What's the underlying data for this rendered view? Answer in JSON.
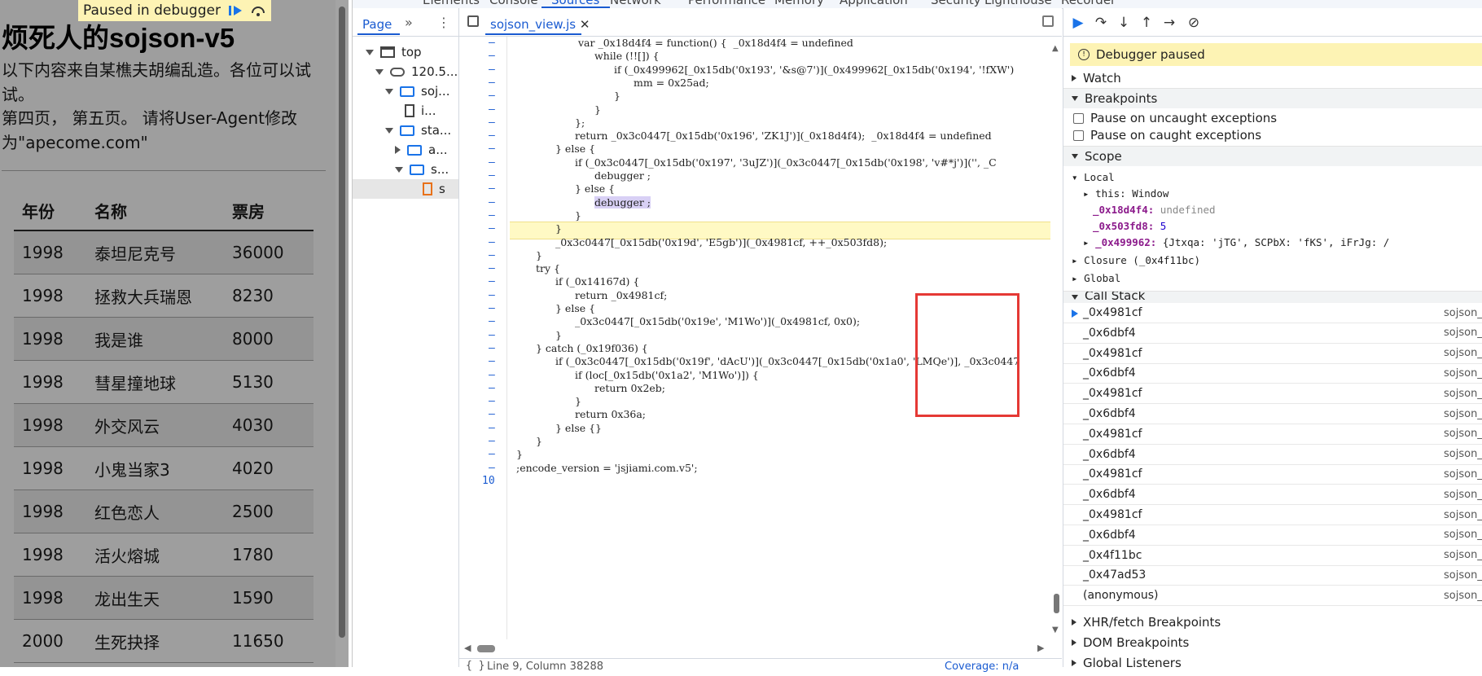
{
  "page": {
    "paused_badge": "Paused in debugger",
    "title": "烦死人的sojson-v5",
    "intro_1": "以下内容来自某樵夫胡编乱造。各位可以试试。",
    "intro_2": "第四页， 第五页。 请将User-Agent修改为\"apecome.com\"",
    "table": {
      "headers": [
        "年份",
        "名称",
        "票房"
      ],
      "rows": [
        [
          "1998",
          "泰坦尼克号",
          "36000"
        ],
        [
          "1998",
          "拯救大兵瑞恩",
          "8230"
        ],
        [
          "1998",
          "我是谁",
          "8000"
        ],
        [
          "1998",
          "彗星撞地球",
          "5130"
        ],
        [
          "1998",
          "外交风云",
          "4030"
        ],
        [
          "1998",
          "小鬼当家3",
          "4020"
        ],
        [
          "1998",
          "红色恋人",
          "2500"
        ],
        [
          "1998",
          "活火熔城",
          "1780"
        ],
        [
          "1998",
          "龙出生天",
          "1590"
        ],
        [
          "2000",
          "生死抉择",
          "11650"
        ]
      ]
    }
  },
  "devtools": {
    "top_tabs": [
      "Elements",
      "Console",
      "Sources",
      "Network",
      "Performance",
      "Memory",
      "Application",
      "Security",
      "Lighthouse",
      "Recorder"
    ],
    "navigator": {
      "tab": "Page",
      "tree": [
        {
          "label": "top"
        },
        {
          "label": "120.5..."
        },
        {
          "label": "soj..."
        },
        {
          "label": "i..."
        },
        {
          "label": "sta..."
        },
        {
          "label": "a..."
        },
        {
          "label": "s..."
        },
        {
          "label": "s"
        }
      ]
    },
    "editor": {
      "file_tab": "sojson_view.js",
      "gutter_dash": "–",
      "last_line_number": "10",
      "code_lines": [
        "var _0x18d4f4 = function() {  _0x18d4f4 = undefined",
        "while (!![]) {",
        "if (_0x499962[_0x15db('0x193', '&s@7')](_0x499962[_0x15db('0x194', '!fXW')",
        "mm = 0x25ad;",
        "}",
        "}",
        "};",
        "return _0x3c0447[_0x15db('0x196', 'ZK1J')](_0x18d4f4);  _0x18d4f4 = undefined",
        "} else {",
        "if (_0x3c0447[_0x15db('0x197', '3uJZ')](_0x3c0447[_0x15db('0x198', 'v#*j')]('', _C",
        "debugger ;",
        "} else {",
        "debugger ;",
        "}",
        "}",
        "_0x3c0447[_0x15db('0x19d', 'E5gb')](_0x4981cf, ++_0x503fd8);",
        "}",
        "try {",
        "if (_0x14167d) {",
        "return _0x4981cf;",
        "} else {",
        "_0x3c0447[_0x15db('0x19e', 'M1Wo')](_0x4981cf, 0x0);",
        "}",
        "} catch (_0x19f036) {",
        "if (_0x3c0447[_0x15db('0x19f', 'dAcU')](_0x3c0447[_0x15db('0x1a0', 'LMQe')], _0x3c0447",
        "if (loc[_0x15db('0x1a2', 'M1Wo')]) {",
        "return 0x2eb;",
        "}",
        "return 0x36a;",
        "} else {}",
        "}",
        "}",
        ";encode_version = 'jsjiami.com.v5';"
      ],
      "status": "Line 9, Column 38288",
      "coverage": "Coverage: n/a"
    },
    "sidebar": {
      "paused_banner": "Debugger paused",
      "watch": "Watch",
      "breakpoints": "Breakpoints",
      "pause_uncaught": "Pause on uncaught exceptions",
      "pause_caught": "Pause on caught exceptions",
      "scope": "Scope",
      "local": "Local",
      "this_label": "this: Window",
      "var1_name": "_0x18d4f4:",
      "var1_val": "undefined",
      "var2_name": "_0x503fd8:",
      "var2_val": "5",
      "var3_name": "_0x499962:",
      "var3_val": "{Jtxqa: 'jTG', SCPbX: 'fKS', iFrJg: /",
      "closure": "Closure (_0x4f11bc)",
      "global": "Global",
      "call_stack": "Call Stack",
      "frames": [
        {
          "fn": "_0x4981cf",
          "loc": "sojson_"
        },
        {
          "fn": "_0x6dbf4",
          "loc": "sojson_"
        },
        {
          "fn": "_0x4981cf",
          "loc": "sojson_"
        },
        {
          "fn": "_0x6dbf4",
          "loc": "sojson_"
        },
        {
          "fn": "_0x4981cf",
          "loc": "sojson_"
        },
        {
          "fn": "_0x6dbf4",
          "loc": "sojson_"
        },
        {
          "fn": "_0x4981cf",
          "loc": "sojson_"
        },
        {
          "fn": "_0x6dbf4",
          "loc": "sojson_"
        },
        {
          "fn": "_0x4981cf",
          "loc": "sojson_"
        },
        {
          "fn": "_0x6dbf4",
          "loc": "sojson_"
        },
        {
          "fn": "_0x4981cf",
          "loc": "sojson_"
        },
        {
          "fn": "_0x6dbf4",
          "loc": "sojson_"
        },
        {
          "fn": "_0x4f11bc",
          "loc": "sojson_"
        },
        {
          "fn": "_0x47ad53",
          "loc": "sojson_"
        },
        {
          "fn": "(anonymous)",
          "loc": "sojson_"
        }
      ],
      "xhr_breakpoints": "XHR/fetch Breakpoints",
      "dom_breakpoints": "DOM Breakpoints",
      "global_listeners": "Global Listeners"
    }
  },
  "colors": {
    "accent": "#1a5bd1",
    "paused_yellow": "#fdf3b4",
    "highlight_red": "#e53935"
  }
}
